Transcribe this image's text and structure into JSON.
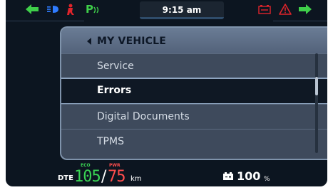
{
  "status": {
    "time": "9:15 am",
    "park_label": "P",
    "colors": {
      "green": "#3fcf4a",
      "red": "#e0242b",
      "blue": "#2f7cff"
    },
    "icons": [
      "left-turn-arrow-icon",
      "headlight-icon",
      "kickstand-icon",
      "park-mode-icon",
      "battery-warning-icon",
      "warning-triangle-icon",
      "right-turn-arrow-icon"
    ]
  },
  "menu": {
    "title": "MY VEHICLE",
    "items": [
      {
        "label": "Service",
        "selected": false
      },
      {
        "label": "Errors",
        "selected": true
      },
      {
        "label": "Digital Documents",
        "selected": false
      },
      {
        "label": "TPMS",
        "selected": false
      }
    ]
  },
  "range": {
    "dte_label": "DTE",
    "eco_label": "ECO",
    "eco_value": "105",
    "separator": "/",
    "pwr_label": "PWR",
    "pwr_value": "75",
    "unit": "km"
  },
  "battery": {
    "value": "100",
    "unit": "%"
  }
}
